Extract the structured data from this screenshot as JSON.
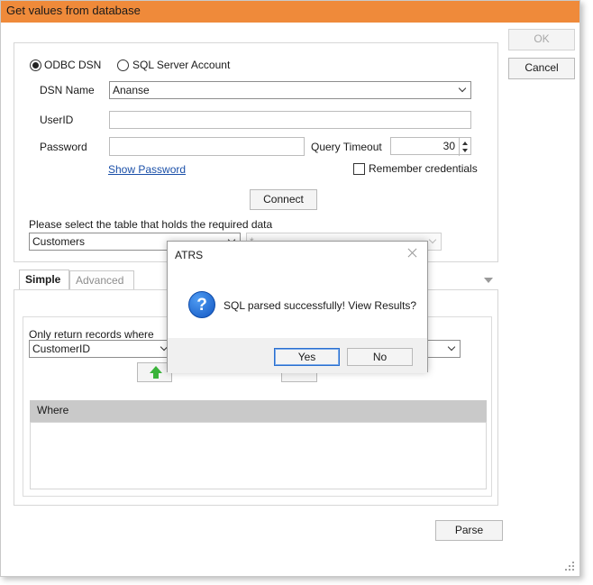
{
  "window": {
    "title": "Get values from database"
  },
  "buttons": {
    "ok": "OK",
    "cancel": "Cancel",
    "connect": "Connect",
    "parse": "Parse"
  },
  "connection": {
    "odbc_label": "ODBC DSN",
    "sql_label": "SQL Server Account",
    "odbc_selected": true,
    "dsn_label": "DSN Name",
    "dsn_value": "Ananse",
    "userid_label": "UserID",
    "userid_value": "",
    "password_label": "Password",
    "password_value": "",
    "timeout_label": "Query Timeout",
    "timeout_value": "30",
    "show_password": "Show Password",
    "remember_label": "Remember credentials",
    "remember_checked": false
  },
  "table_select": {
    "prompt": "Please select the table that holds the required data",
    "table_value": "Customers",
    "column_value": "*"
  },
  "tabs": [
    {
      "label": "Simple",
      "active": true
    },
    {
      "label": "Advanced",
      "active": false
    }
  ],
  "filter": {
    "label": "Only return records where",
    "field_value": "CustomerID",
    "grid_header": "Where"
  },
  "dialog": {
    "title": "ATRS",
    "message": "SQL parsed successfully! View Results?",
    "yes": "Yes",
    "no": "No",
    "icon": "info-question-icon"
  },
  "colors": {
    "titlebar": "#ef8a3a",
    "accent": "#1357c2",
    "link": "#1a4fa8"
  }
}
